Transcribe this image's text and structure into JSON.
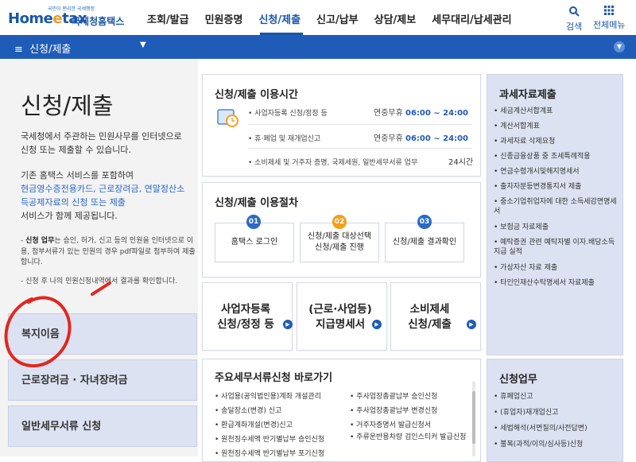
{
  "header": {
    "logo_small": "국민이 편리한 국세행정",
    "logo_home": "Home",
    "logo_e": "e",
    "logo_tax": "tax",
    "logo_kr": "국세청홈택스",
    "nav": [
      "조회/발급",
      "민원증명",
      "신청/제출",
      "신고/납부",
      "상담/제보",
      "세무대리/납세관리"
    ],
    "active_nav": "신청/제출",
    "search_label": "검색",
    "menu_label": "전체메뉴"
  },
  "bar": {
    "current_menu": "신청/제출"
  },
  "left": {
    "title": "신청/제출",
    "desc1": "국세청에서 주관하는 민원사무를 인터넷으로 신청 또는 제출할 수 있습니다.",
    "desc2_prefix": "기존 홈택스 서비스를 포함하여",
    "desc2_link": "현금영수증전용카드, 근로장려금, 연말정산소득공제자료의 신청 또는 제출",
    "desc2_suffix": "서비스가 함께 제공됩니다.",
    "note1_bold": "신청 업무",
    "note1_text": "는 승인, 허가, 신고 등의 민원을 인터넷으로 이용, 첨부서류가 있는 민원의 경우 pdf파일로 첨부하여 제출합니다.",
    "note2": "신청 후 나의 민원신청내역에서 결과를 확인합니다.",
    "buttons": [
      "복지이음",
      "근로장려금 · 자녀장려금",
      "일반세무서류 신청"
    ]
  },
  "hours": {
    "title": "신청/제출 이용시간",
    "rows": [
      {
        "label": "사업자등록 신청/정정 등",
        "days": "연중무휴",
        "time": "06:00 ~ 24:00"
      },
      {
        "label": "휴·폐업 및 재개업신고",
        "days": "연중무휴",
        "time": "06:00 ~ 24:00"
      },
      {
        "label": "소비제세 및 거주자 증명, 국제세원, 일반세무서류 업무",
        "days": "",
        "time": "24시간"
      }
    ]
  },
  "procedure": {
    "title": "신청/제출 이용절차",
    "steps": [
      {
        "num": "01",
        "label": "홈택스 로그인",
        "color": "#2a6bc4"
      },
      {
        "num": "02",
        "label": "신청/제출 대상선택 신청/제출 진행",
        "color": "#f2a01a"
      },
      {
        "num": "03",
        "label": "신청/제출 결과확인",
        "color": "#2a6bc4"
      }
    ]
  },
  "shortcuts": [
    {
      "line1": "사업자등록",
      "line2": "신청/정정 등"
    },
    {
      "line1": "(근로·사업등)",
      "line2": "지급명세서"
    },
    {
      "line1": "소비제세",
      "line2": "신청/제출"
    }
  ],
  "main_docs": {
    "title": "주요세무서류신청 바로가기",
    "col1": [
      "사업용(공익법인용)계좌 개설관리",
      "송달장소(변경) 신고",
      "환급계좌개설(변경)신고",
      "원천징수세액 반기별납부 승인신청",
      "원천징수세액 반기별납부 포기신청"
    ],
    "col2": [
      "주사업장총괄납부 승인신청",
      "주사업장총괄납부 변경신청",
      "거주자증명서 발급신청서",
      "주류운반용차량 검인스티커 발급신청"
    ]
  },
  "tax_data": {
    "title": "과세자료제출",
    "items": [
      "세금계산서합계표",
      "계산서합계표",
      "과세자료 삭제요청",
      "신종금융상품 중 조세특례적용",
      "연금수령개시및해지명세서",
      "출자자분등변경통지서 제출",
      "중소기업취업자에 대한 소득세감면명세서",
      "보험금 자료제출",
      "예탁증권 관련 예탁자별 이자.배당소득 지급 실적",
      "가상자산 자료 제출",
      "타인인재산수탁명세서 자료제출"
    ]
  },
  "apply_work": {
    "title": "신청업무",
    "items": [
      "휴폐업신고",
      "(휴업자)재개업신고",
      "세법해석(서면질의/사전답변)",
      "불복(과적/이의/심사등)신청"
    ]
  },
  "colors": {
    "brand_blue": "#1f5cb8",
    "link_blue": "#2a68c8",
    "orange": "#f2a01a",
    "annotation_red": "#e0281e"
  }
}
